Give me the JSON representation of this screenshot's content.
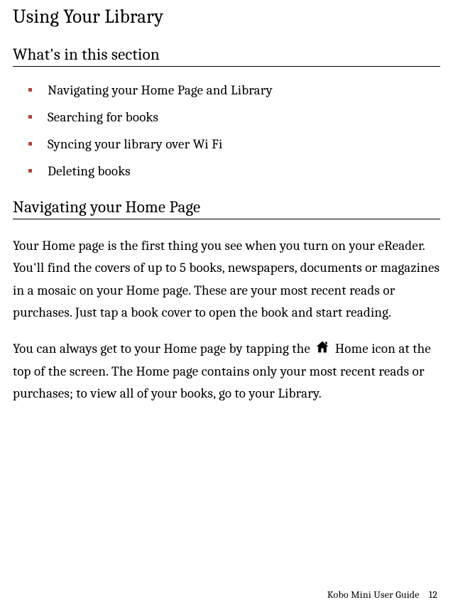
{
  "title": "Using Your Library",
  "section1": {
    "heading": "What's in this section",
    "items": [
      "Navigating your Home Page and Library",
      "Searching for books",
      "Syncing your library over Wi Fi",
      "Deleting books"
    ]
  },
  "section2": {
    "heading": "Navigating your Home Page",
    "para1": "Your Home page is the first thing you see when you turn on your eReader. You'll find the covers of up to 5 books, newspapers, documents or magazines in a mosaic on your Home page. These are your most recent reads or purchases. Just tap a book cover to open the book and start reading.",
    "para2_pre": "You can always get to your Home page by tapping the ",
    "para2_post": " Home icon at the top of the screen. The Home page contains only your most recent reads or purchases; to view all of your books, go to your Library."
  },
  "footer": {
    "guide": "Kobo Mini User Guide",
    "page": "12"
  }
}
